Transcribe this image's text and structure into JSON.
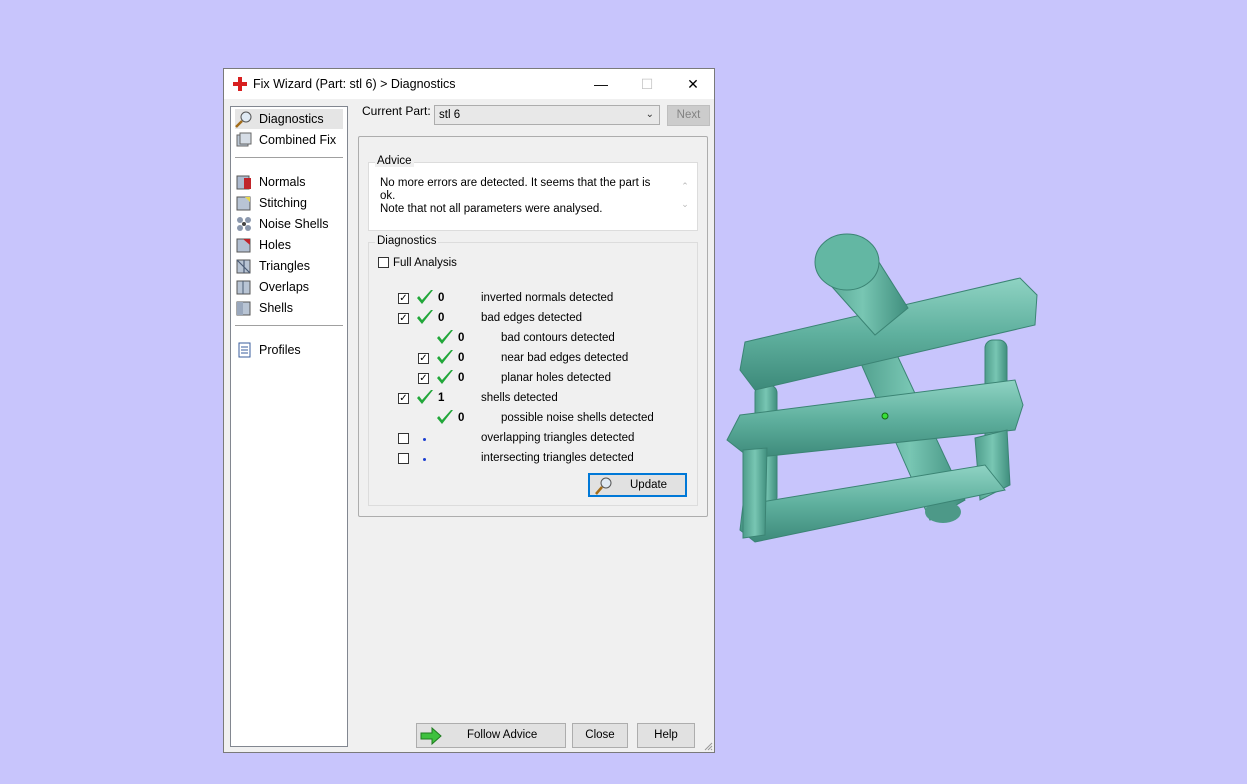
{
  "window": {
    "title": "Fix Wizard (Part: stl 6) > Diagnostics",
    "minimize": "—",
    "maximize": "☐",
    "close": "✕"
  },
  "sidebar": {
    "items_top": [
      {
        "label": "Diagnostics",
        "icon": "magnifier-icon",
        "active": true
      },
      {
        "label": "Combined Fix",
        "icon": "combined-fix-icon"
      }
    ],
    "items_fix": [
      {
        "label": "Normals",
        "icon": "normals-icon"
      },
      {
        "label": "Stitching",
        "icon": "stitching-icon"
      },
      {
        "label": "Noise Shells",
        "icon": "noise-shells-icon"
      },
      {
        "label": "Holes",
        "icon": "holes-icon"
      },
      {
        "label": "Triangles",
        "icon": "triangles-icon"
      },
      {
        "label": "Overlaps",
        "icon": "overlaps-icon"
      },
      {
        "label": "Shells",
        "icon": "shells-icon"
      }
    ],
    "items_bottom": [
      {
        "label": "Profiles",
        "icon": "profiles-icon"
      }
    ]
  },
  "current_part": {
    "label": "Current Part:",
    "value": "stl 6",
    "next_label": "Next"
  },
  "advice": {
    "legend": "Advice",
    "text": "No more errors are detected. It seems that the part is ok.\nNote that not all parameters were analysed."
  },
  "diagnostics": {
    "legend": "Diagnostics",
    "full_analysis_label": "Full Analysis",
    "full_analysis_checked": false,
    "rows": [
      {
        "checkbox": true,
        "checked": true,
        "status": "ok",
        "count": "0",
        "label": "inverted normals detected"
      },
      {
        "checkbox": true,
        "checked": true,
        "status": "ok",
        "count": "0",
        "label": "bad edges detected"
      },
      {
        "checkbox": false,
        "status": "ok",
        "count": "0",
        "label": "bad contours detected"
      },
      {
        "checkbox": true,
        "checked": true,
        "status": "ok",
        "count": "0",
        "label": "near bad edges detected"
      },
      {
        "checkbox": true,
        "checked": true,
        "status": "ok",
        "count": "0",
        "label": "planar holes detected"
      },
      {
        "checkbox": true,
        "checked": true,
        "status": "ok",
        "count": "1",
        "label": "shells detected"
      },
      {
        "checkbox": false,
        "status": "ok",
        "count": "0",
        "label": "possible noise shells detected"
      },
      {
        "checkbox": true,
        "checked": false,
        "status": "unknown",
        "count": "",
        "label": "overlapping triangles detected"
      },
      {
        "checkbox": true,
        "checked": false,
        "status": "unknown",
        "count": "",
        "label": "intersecting triangles detected"
      }
    ],
    "update_label": "Update"
  },
  "footer": {
    "follow_advice_label": "Follow Advice",
    "close_label": "Close",
    "help_label": "Help"
  },
  "colors": {
    "background": "#c8c5fc",
    "model": "#5fb09e",
    "check": "#22a73a",
    "accent": "#0078d7"
  }
}
